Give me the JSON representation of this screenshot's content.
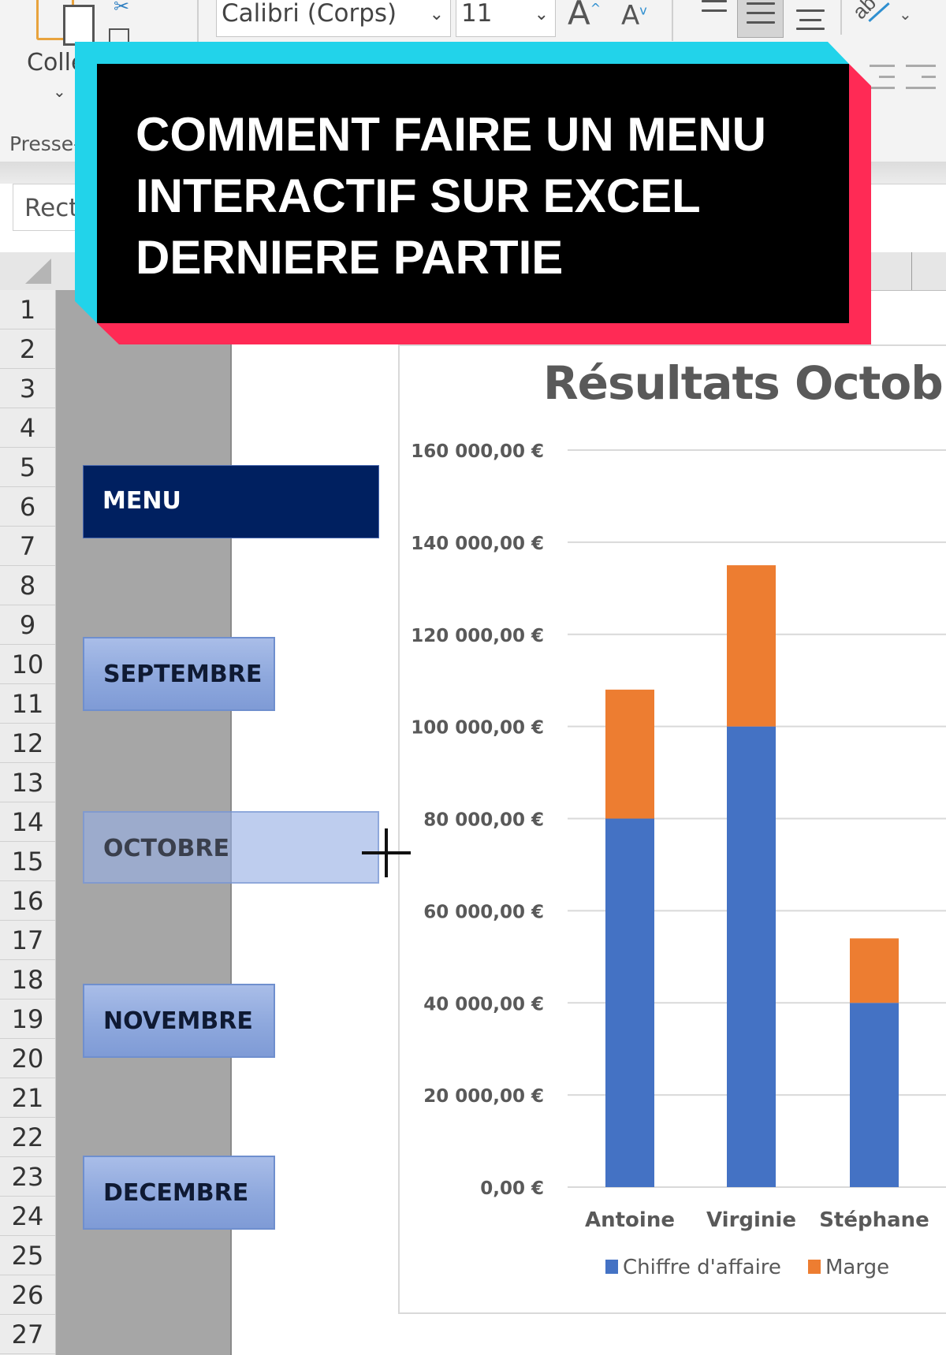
{
  "ribbon": {
    "clipboard": {
      "paste_label": "Colle",
      "paste_chevron": "⌄",
      "group_label": "Presse-"
    },
    "font": {
      "family_value": "Calibri (Corps)",
      "size_value": "11",
      "grow_label": "A",
      "shrink_label": "A",
      "grow_glyph": "^",
      "shrink_glyph": "v"
    },
    "alignment": {
      "active": "middle-align",
      "orientation_glyph": "ab",
      "chevron": "⌄"
    }
  },
  "namebox": {
    "value": "Rect"
  },
  "rows": [
    "1",
    "2",
    "3",
    "4",
    "5",
    "6",
    "7",
    "8",
    "9",
    "10",
    "11",
    "12",
    "13",
    "14",
    "15",
    "16",
    "17",
    "18",
    "19",
    "20",
    "21",
    "22",
    "23",
    "24",
    "25",
    "26",
    "27"
  ],
  "menu": {
    "header_label": "MENU",
    "items": [
      {
        "label": "SEPTEMBRE",
        "selected": false
      },
      {
        "label": "OCTOBRE",
        "selected": true
      },
      {
        "label": "NOVEMBRE",
        "selected": false
      },
      {
        "label": "DECEMBRE",
        "selected": false
      }
    ],
    "colors": {
      "header": "#002060",
      "button": "#8EA8DD"
    }
  },
  "banner": {
    "lines": [
      "COMMENT FAIRE UN MENU",
      "INTERACTIF SUR EXCEL",
      "DERNIERE PARTIE"
    ],
    "colors": {
      "background": "#000000",
      "accent_left": "#22D3EA",
      "accent_right": "#FF2A55",
      "text": "#FFFFFF"
    }
  },
  "chart_data": {
    "type": "bar",
    "stacked": true,
    "title": "Résultats Octobre",
    "categories": [
      "Antoine",
      "Virginie",
      "Stéphane"
    ],
    "series": [
      {
        "name": "Chiffre d'affaire",
        "values": [
          80000,
          100000,
          40000
        ],
        "color": "#4472C4"
      },
      {
        "name": "Marge",
        "values": [
          28000,
          35000,
          14000
        ],
        "color": "#ED7D31"
      }
    ],
    "xlabel": "",
    "ylabel": "",
    "ylim": [
      0,
      160000
    ],
    "yticks": [
      0,
      20000,
      40000,
      60000,
      80000,
      100000,
      120000,
      140000,
      160000
    ],
    "ytick_labels": [
      "0,00 €",
      "20 000,00 €",
      "40 000,00 €",
      "60 000,00 €",
      "80 000,00 €",
      "100 000,00 €",
      "120 000,00 €",
      "140 000,00 €",
      "160 000,00 €"
    ],
    "grid": true,
    "legend": "bottom"
  }
}
